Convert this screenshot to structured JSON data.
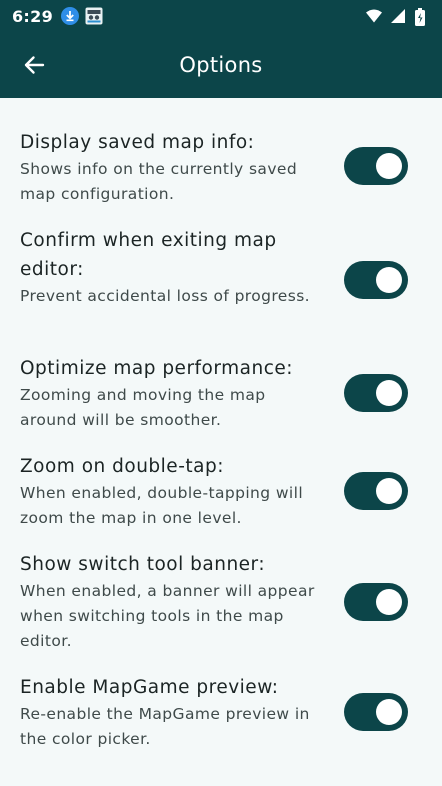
{
  "status_bar": {
    "time": "6:29",
    "notification_icons": [
      "download-icon",
      "image-icon"
    ],
    "system_icons": [
      "wifi-icon",
      "signal-icon",
      "battery-icon"
    ]
  },
  "app_bar": {
    "title": "Options",
    "back_icon": "arrow-left-icon"
  },
  "colors": {
    "primary": "#0c4549",
    "background": "#f4f9f9",
    "knob": "#ffffff"
  },
  "options": [
    {
      "title": "Display saved map info:",
      "description": "Shows info on the currently saved map configuration.",
      "enabled": true
    },
    {
      "title": "Confirm when exiting map editor:",
      "description": "Prevent accidental loss of progress.",
      "enabled": true
    },
    {
      "title": "Optimize map performance:",
      "description": "Zooming and moving the map around will be smoother.",
      "enabled": true
    },
    {
      "title": "Zoom on double-tap:",
      "description": "When enabled, double-tapping will zoom the map in one level.",
      "enabled": true
    },
    {
      "title": "Show switch tool banner:",
      "description": "When enabled, a banner will appear when switching tools in the map editor.",
      "enabled": true
    },
    {
      "title": "Enable MapGame preview:",
      "description": "Re-enable the MapGame preview in the color picker.",
      "enabled": true
    }
  ]
}
